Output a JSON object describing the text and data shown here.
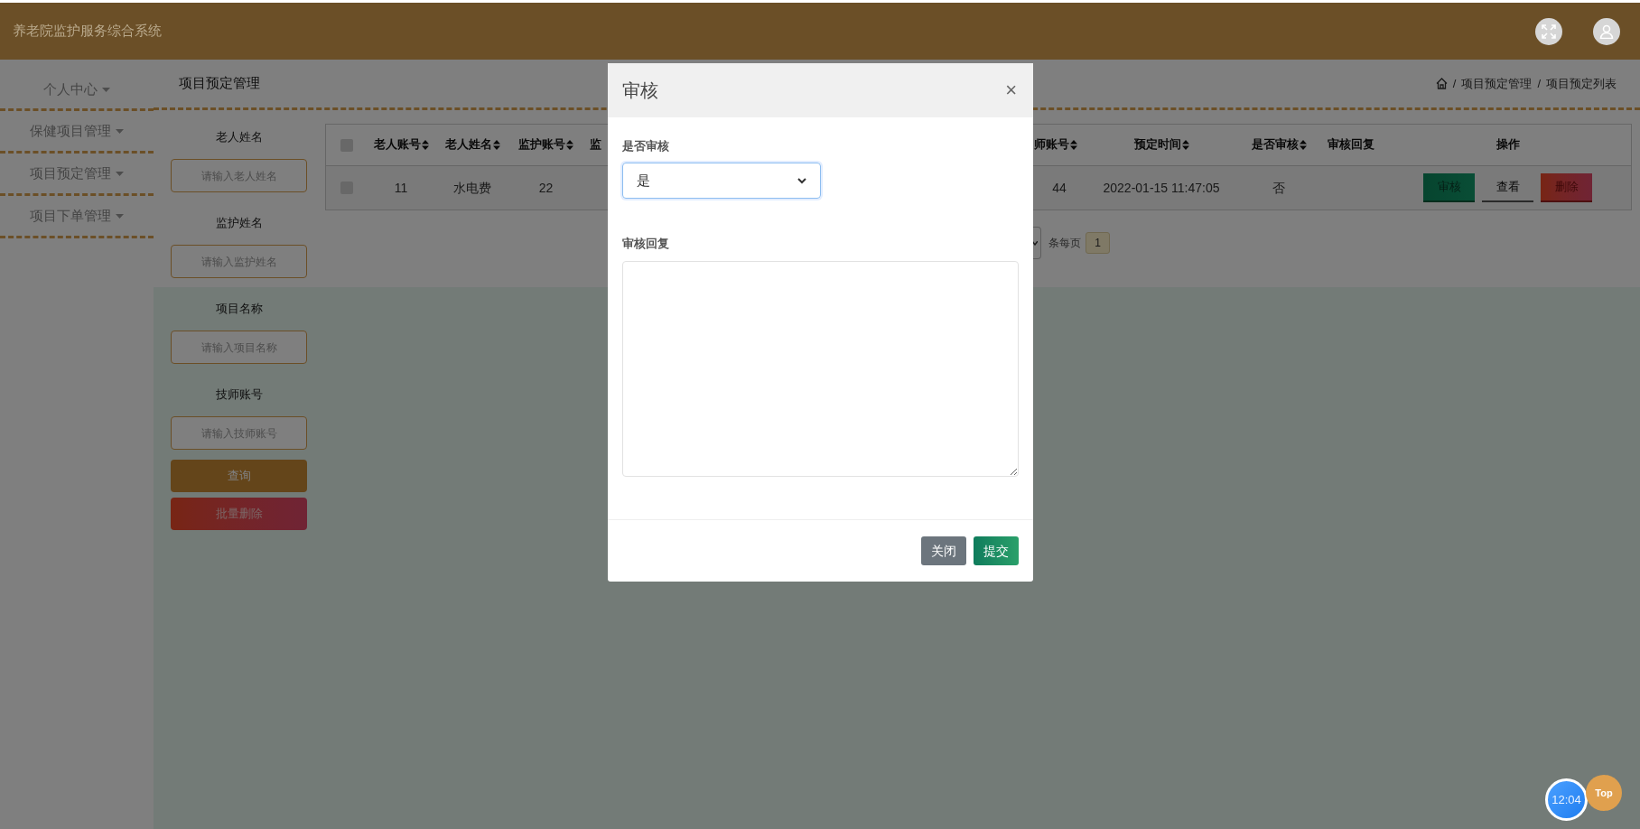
{
  "header": {
    "title": "养老院监护服务综合系统"
  },
  "sidebar": {
    "items": [
      {
        "label": "个人中心",
        "expanded": false
      },
      {
        "label": "保健项目管理",
        "expanded": false
      },
      {
        "label": "项目预定管理",
        "expanded": false
      },
      {
        "label": "项目下单管理",
        "expanded": false
      }
    ]
  },
  "page_title": "项目预定管理",
  "breadcrumb": {
    "separator": "/",
    "items": [
      "项目预定管理",
      "项目预定列表"
    ]
  },
  "search": {
    "fields": [
      {
        "label": "老人姓名",
        "placeholder": "请输入老人姓名"
      },
      {
        "label": "监护姓名",
        "placeholder": "请输入监护姓名"
      },
      {
        "label": "项目名称",
        "placeholder": "请输入项目名称"
      },
      {
        "label": "技师账号",
        "placeholder": "请输入技师账号"
      }
    ],
    "buttons": [
      {
        "label": "查询",
        "kind": "query"
      },
      {
        "label": "批量删除",
        "kind": "danger"
      }
    ]
  },
  "table": {
    "header_checked": false,
    "left_columns": [
      {
        "label": "老人账号",
        "sortable": true
      },
      {
        "label": "老人姓名",
        "sortable": true
      },
      {
        "label": "监护账号",
        "sortable": true
      },
      {
        "label": "监",
        "sortable": false
      }
    ],
    "right_columns": [
      {
        "label": "师账号",
        "sortable": true
      },
      {
        "label": "预定时间",
        "sortable": true
      },
      {
        "label": "是否审核",
        "sortable": true
      },
      {
        "label": "审核回复",
        "sortable": false
      },
      {
        "label": "操作",
        "sortable": false
      }
    ],
    "rows": [
      {
        "checked": false,
        "left_cells": [
          "11",
          "水电费",
          "22"
        ],
        "right_cells": [
          "44",
          "2022-01-15 11:47:05",
          "否"
        ],
        "actions": [
          {
            "label": "审核",
            "kind": "review"
          },
          {
            "label": "查看",
            "kind": "view"
          },
          {
            "label": "删除",
            "kind": "delete"
          }
        ]
      }
    ]
  },
  "pagination": {
    "per_page_label": "条每页",
    "pages": [
      {
        "label": "1",
        "selected": true
      }
    ]
  },
  "modal": {
    "title": "审核",
    "close": "×",
    "fields": [
      {
        "kind": "select",
        "label": "是否审核",
        "value": "是"
      },
      {
        "kind": "textarea",
        "label": "审核回复"
      }
    ],
    "buttons": [
      {
        "label": "关闭",
        "kind": "secondary"
      },
      {
        "label": "提交",
        "kind": "primary"
      }
    ]
  },
  "clock": {
    "time": "12:04"
  },
  "top_button": {
    "label": "Top"
  }
}
